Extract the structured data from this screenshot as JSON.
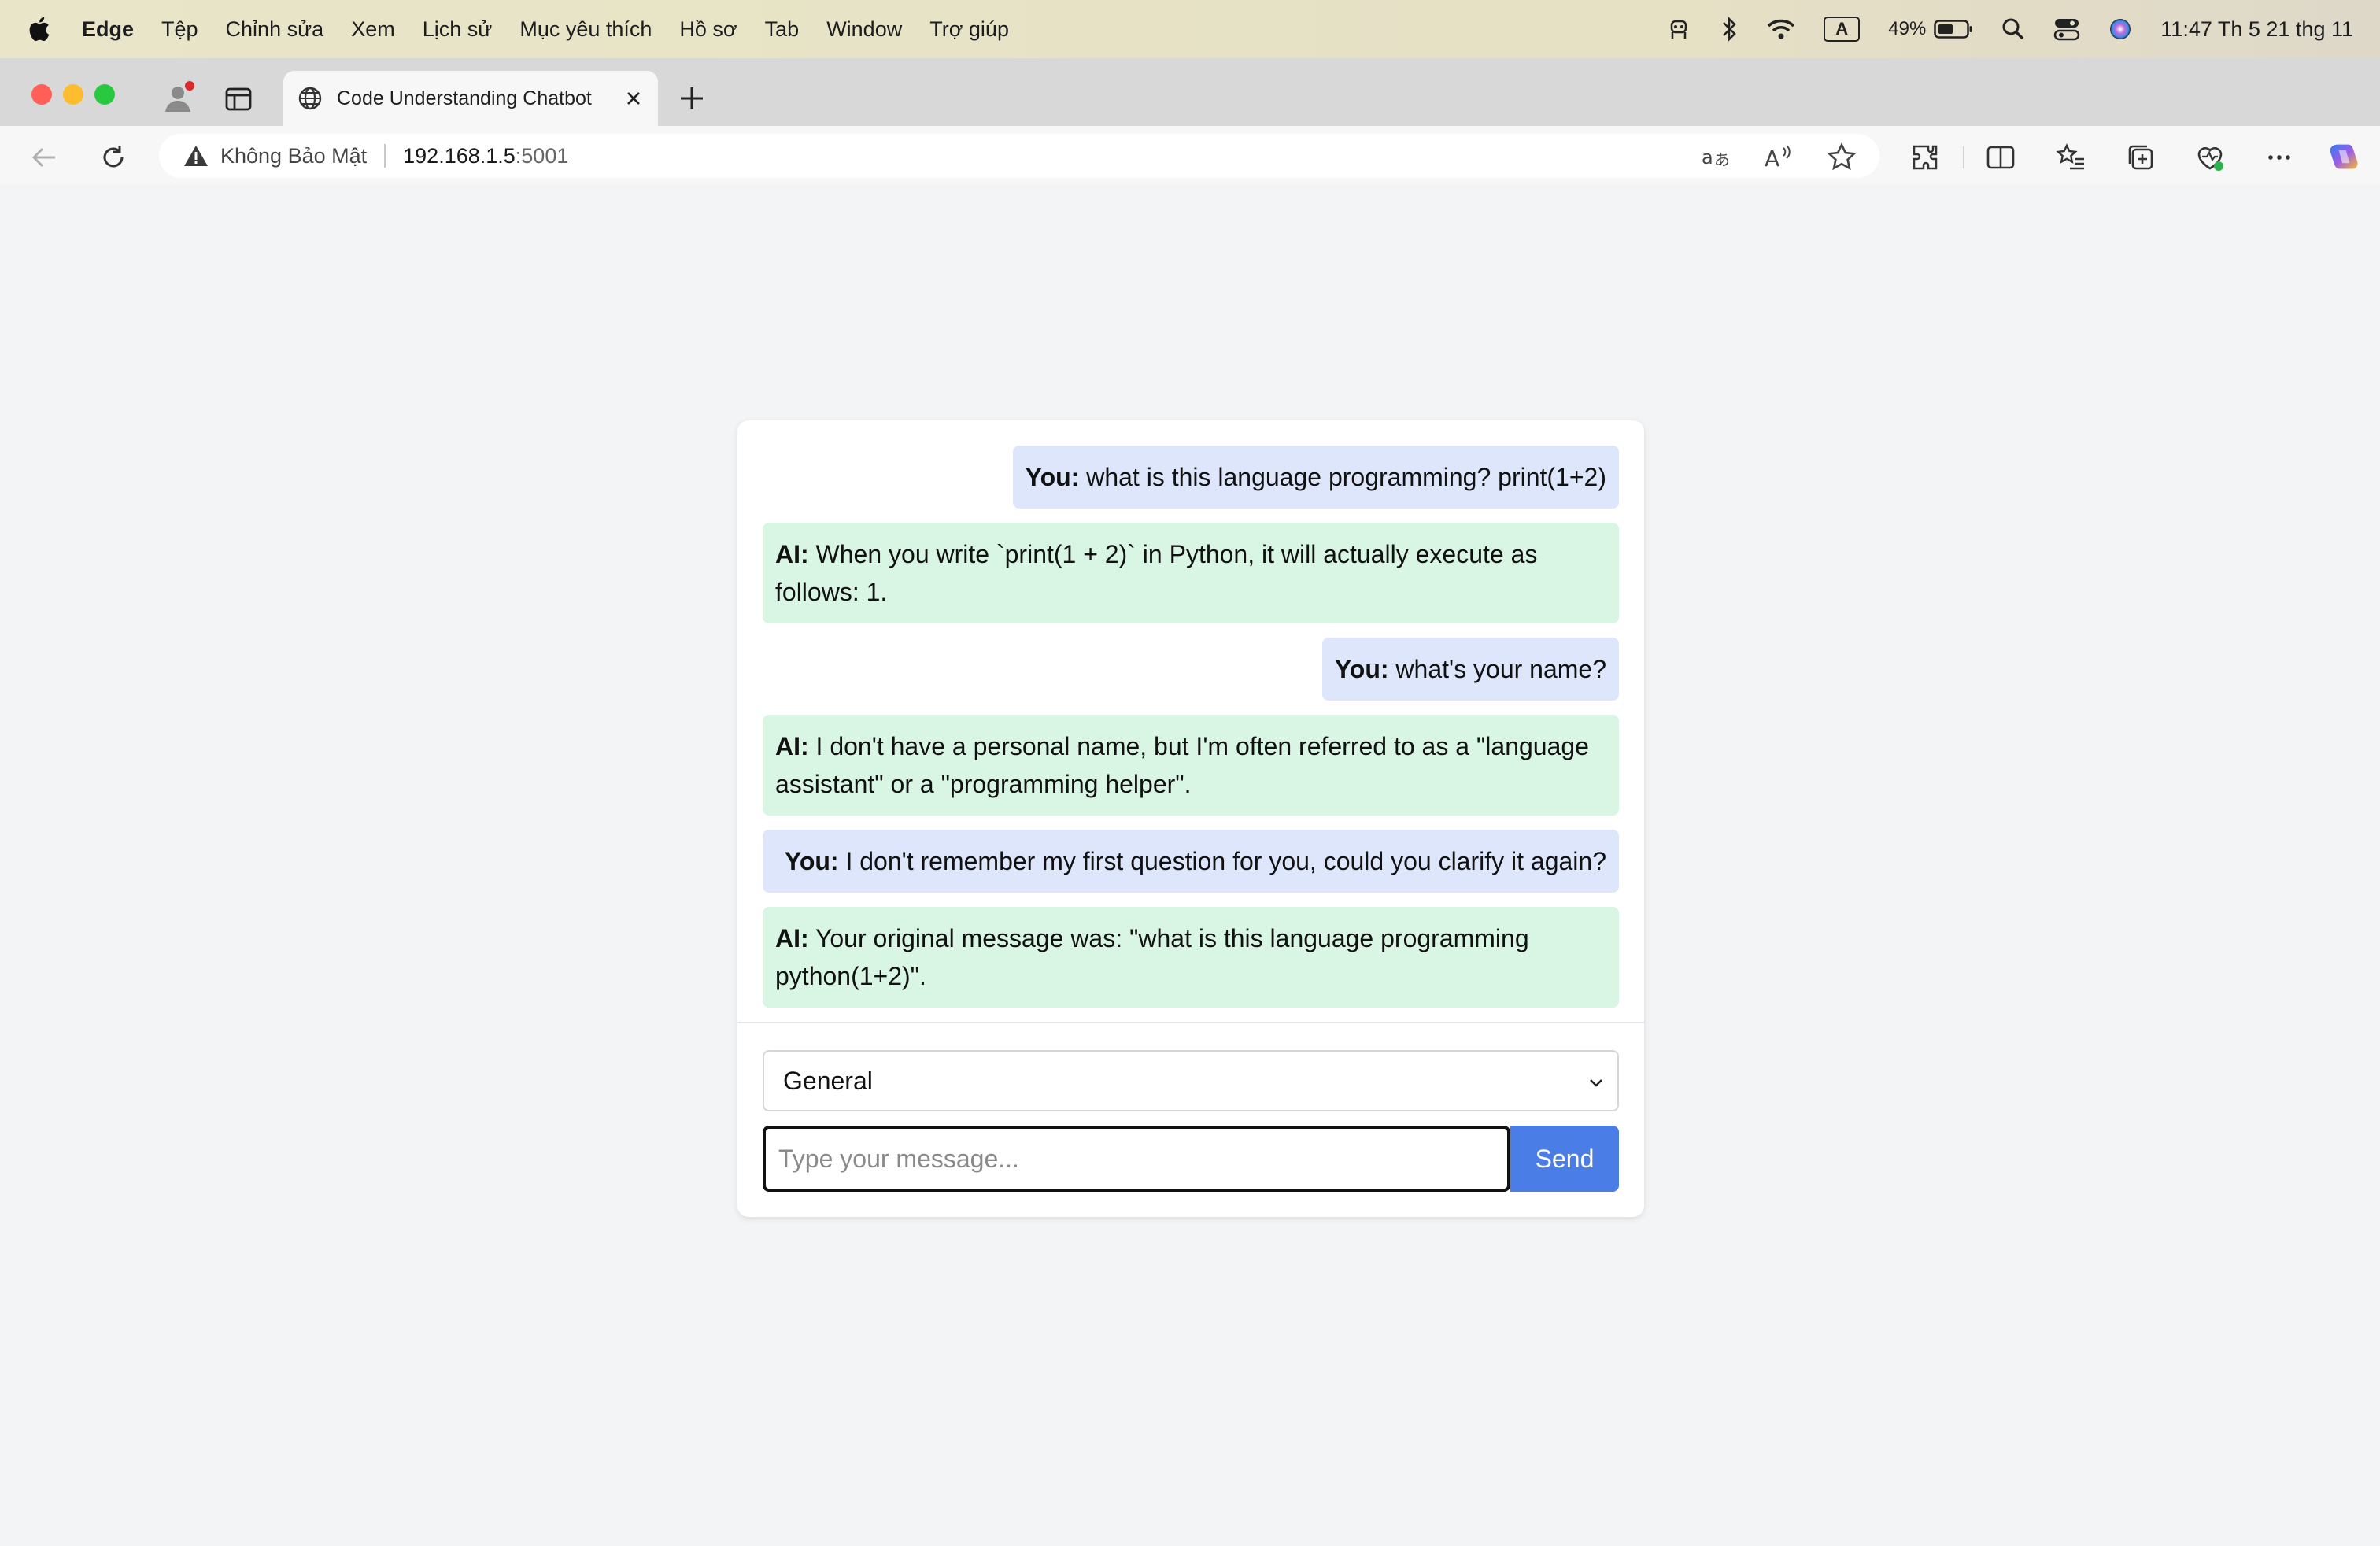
{
  "menubar": {
    "app_name": "Edge",
    "items": [
      "Tệp",
      "Chỉnh sửa",
      "Xem",
      "Lịch sử",
      "Mục yêu thích",
      "Hồ sơ",
      "Tab",
      "Window",
      "Trợ giúp"
    ],
    "battery_percent": "49%",
    "clock": "11:47 Th 5 21 thg 11",
    "input_indicator": "A"
  },
  "browser": {
    "tab_title": "Code Understanding Chatbot",
    "security_label": "Không Bảo Mật",
    "url_host": "192.168.1.5",
    "url_port": ":5001"
  },
  "chat": {
    "messages": [
      {
        "role": "user",
        "speaker": "You:",
        "text": "what is this language programming? print(1+2)"
      },
      {
        "role": "ai",
        "speaker": "AI:",
        "text": "When you write `print(1 + 2)` in Python, it will actually execute as follows: 1."
      },
      {
        "role": "user",
        "speaker": "You:",
        "text": "what's your name?"
      },
      {
        "role": "ai",
        "speaker": "AI:",
        "text": "I don't have a personal name, but I'm often referred to as a \"language assistant\" or a \"programming helper\"."
      },
      {
        "role": "user",
        "speaker": "You:",
        "text": "I don't remember my first question for you, could you clarify it again?"
      },
      {
        "role": "ai",
        "speaker": "AI:",
        "text": "Your original message was: \"what is this language programming python(1+2)\"."
      }
    ]
  },
  "controls": {
    "mode_selected": "General",
    "message_placeholder": "Type your message...",
    "send_label": "Send"
  },
  "colors": {
    "user_bubble": "#dde6fb",
    "ai_bubble": "#d9f6e4",
    "send_button": "#4a7ee6"
  }
}
